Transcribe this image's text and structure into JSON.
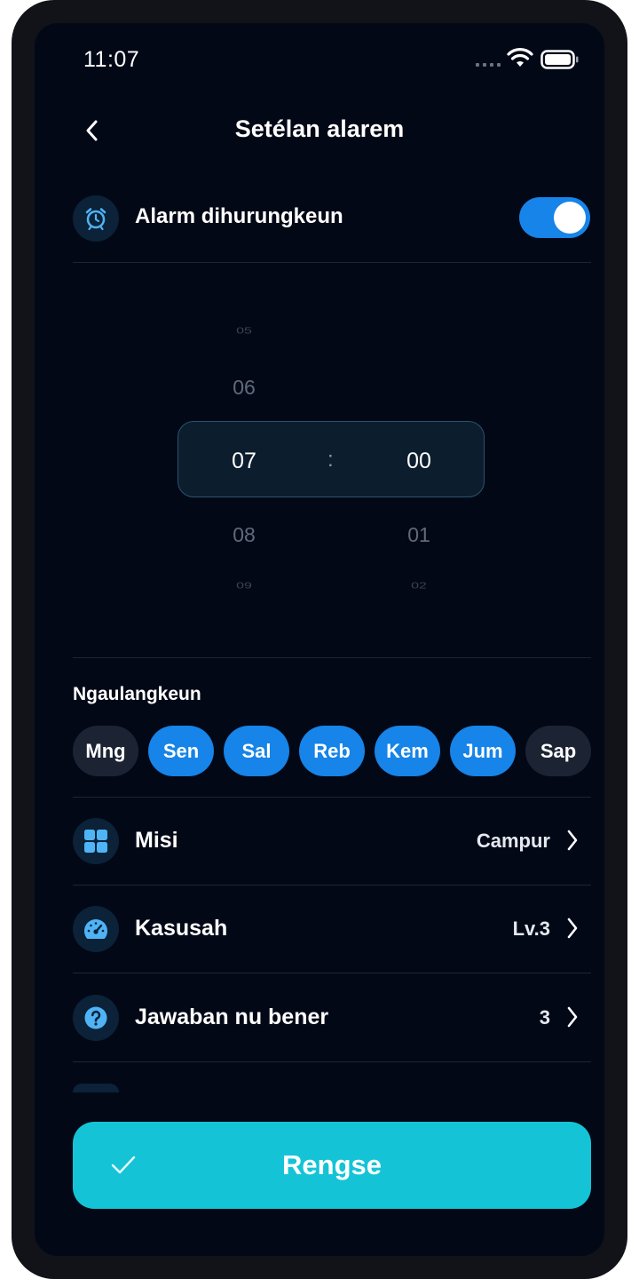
{
  "status_bar": {
    "time": "11:07"
  },
  "header": {
    "title": "Setélan alarem",
    "back_icon": "chevron-left-icon"
  },
  "alarm_toggle": {
    "label": "Alarm dihurungkeun",
    "on": true,
    "icon": "alarm-clock-icon"
  },
  "time_picker": {
    "hours": {
      "far_above": "05",
      "above": "06",
      "selected": "07",
      "below": "08",
      "far_below": "09"
    },
    "separator": ":",
    "minutes": {
      "selected": "00",
      "below": "01",
      "far_below": "02"
    }
  },
  "repeat": {
    "label": "Ngaulangkeun",
    "days": [
      {
        "label": "Mng",
        "active": false
      },
      {
        "label": "Sen",
        "active": true
      },
      {
        "label": "Sal",
        "active": true
      },
      {
        "label": "Reb",
        "active": true
      },
      {
        "label": "Kem",
        "active": true
      },
      {
        "label": "Jum",
        "active": true
      },
      {
        "label": "Sap",
        "active": false
      }
    ]
  },
  "settings": [
    {
      "label": "Misi",
      "value": "Campur",
      "icon": "grid-icon"
    },
    {
      "label": "Kasusah",
      "value": "Lv.3",
      "icon": "speedometer-icon"
    },
    {
      "label": "Jawaban nu bener",
      "value": "3",
      "icon": "question-icon"
    }
  ],
  "done_button": {
    "label": "Rengse",
    "icon": "check-icon"
  },
  "colors": {
    "accent": "#1684e8",
    "cta": "#14c4d6",
    "background": "#030817"
  }
}
